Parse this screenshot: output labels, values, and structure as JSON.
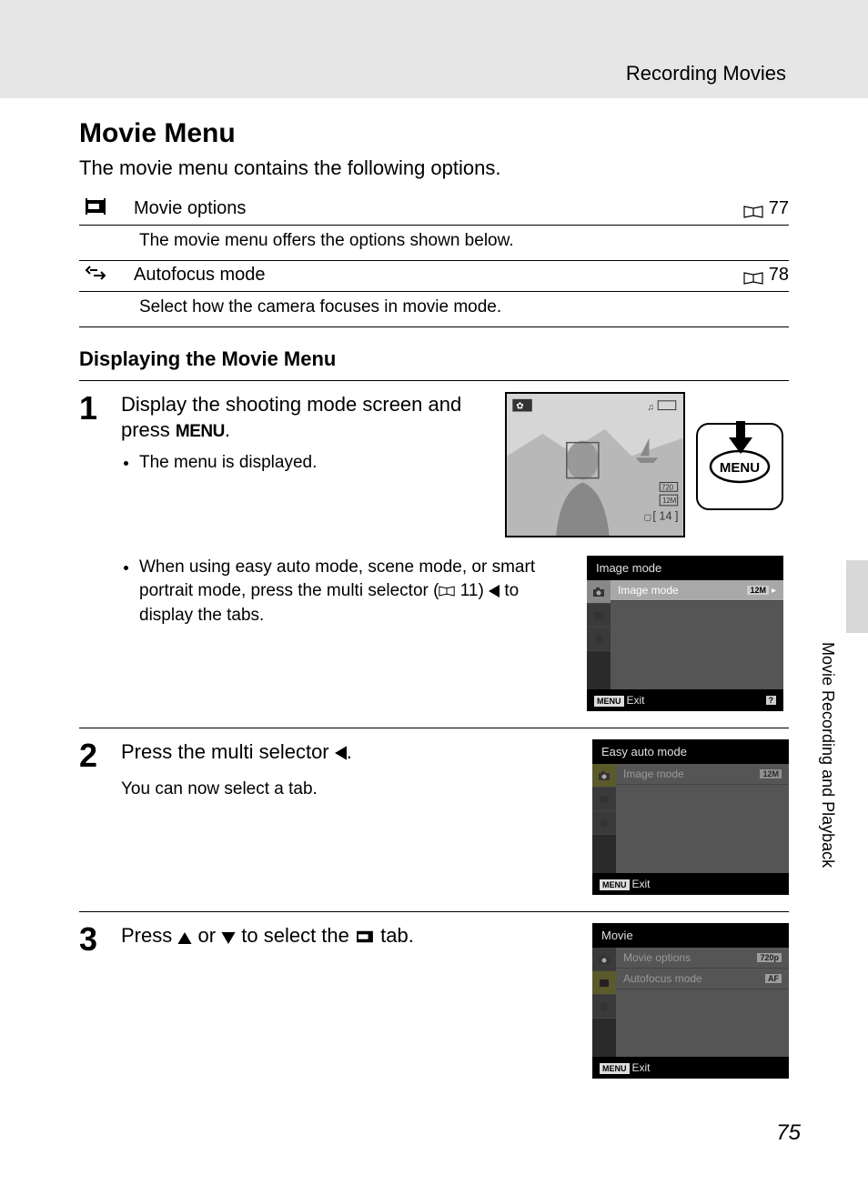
{
  "chapter": "Recording Movies",
  "section_title": "Movie Menu",
  "intro": "The movie menu contains the following options.",
  "menu_items": [
    {
      "label": "Movie options",
      "page": "77",
      "desc": "The movie menu offers the options shown below."
    },
    {
      "label": "Autofocus mode",
      "page": "78",
      "desc": "Select how the camera focuses in movie mode."
    }
  ],
  "subsection_title": "Displaying the Movie Menu",
  "steps": {
    "s1": {
      "text_a": "Display the shooting mode screen and press ",
      "menu_label": "MENU",
      "text_b": ".",
      "bullet1": "The menu is displayed.",
      "bullet2_a": "When using easy auto mode, scene mode, or smart portrait mode, press the multi selector (",
      "bullet2_ref": "11",
      "bullet2_b": ") ",
      "bullet2_c": " to display the tabs.",
      "lcd_count": "14",
      "lcd_res": "720",
      "button_label": "MENU"
    },
    "s2": {
      "text_a": "Press the multi selector ",
      "text_b": ".",
      "sub": "You can now select a tab."
    },
    "s3": {
      "text_a": "Press ",
      "text_b": " or ",
      "text_c": " to select the ",
      "text_d": " tab."
    }
  },
  "screenshots": {
    "sc1": {
      "title": "Image mode",
      "row1": "Image mode",
      "row1_val": "12M",
      "exit": "Exit",
      "help": "?",
      "menu_badge": "MENU"
    },
    "sc2": {
      "title": "Easy auto mode",
      "row1": "Image mode",
      "exit": "Exit",
      "menu_badge": "MENU"
    },
    "sc3": {
      "title": "Movie",
      "row1": "Movie options",
      "row1_val": "720p",
      "row2": "Autofocus mode",
      "row2_val": "AF",
      "exit": "Exit",
      "menu_badge": "MENU"
    }
  },
  "side_label": "Movie Recording and Playback",
  "page_number": "75"
}
